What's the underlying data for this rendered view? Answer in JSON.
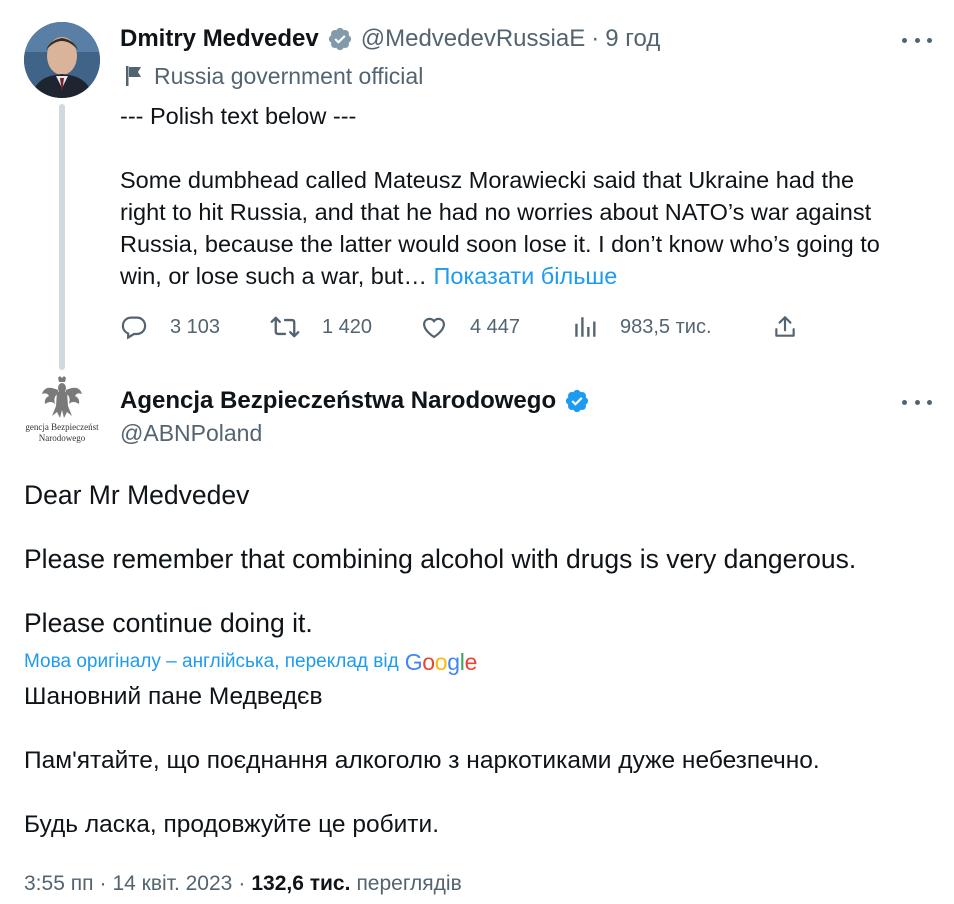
{
  "tweet1": {
    "author_name": "Dmitry Medvedev",
    "handle": "@MedvedevRussiaE",
    "dot": "·",
    "time": "9 год",
    "label": "Russia government official",
    "text_line1": "--- Polish text below ---",
    "text_p2_1": "Some dumbhead called Mateusz Morawiecki said that Ukraine had the",
    "text_p2_2": "right to hit Russia, and that he had no worries about NATO’s war against",
    "text_p2_3": "Russia, because the latter would soon lose it. I don’t know who’s going to",
    "text_p2_4": "win, or lose such a war, but…",
    "show_more": "Показати більше",
    "replies": "3 103",
    "retweets": "1 420",
    "likes": "4 447",
    "views": "983,5 тис.",
    "icons": [
      "verified-badge-icon",
      "flag-icon",
      "reply-icon",
      "retweet-icon",
      "like-icon",
      "views-icon",
      "share-icon",
      "more-icon"
    ]
  },
  "tweet2": {
    "author_name": "Agencja Bezpieczeństwa Narodowego",
    "handle": "@ABNPoland",
    "avatar_text_1": "gencja Bezpieczeńst",
    "avatar_text_2": "Narodowego",
    "line1": "Dear Mr Medvedev",
    "line2": "Please remember that combining alcohol with drugs is very dangerous.",
    "line3": "Please continue doing it.",
    "translate_note": "Мова оригіналу – англійська, переклад від",
    "google": {
      "G": "G",
      "o1": "o",
      "o2": "o",
      "g": "g",
      "l": "l",
      "e": "e"
    },
    "ua_line1": "Шановний пане Медведєв",
    "ua_line2": "Пам'ятайте, що поєднання алкоголю з наркотиками дуже небезпечно.",
    "ua_line3": "Будь ласка, продовжуйте це робити.",
    "timestamp": "3:55 пп",
    "date": "14 квіт. 2023",
    "sep": "·",
    "views_count": "132,6 тис.",
    "views_label": "переглядів"
  },
  "colors": {
    "accent": "#1d9bf0",
    "text": "#0f1419",
    "muted": "#536471",
    "thread_line": "#cfd9de",
    "google_blue": "#4285F4",
    "google_red": "#EA4335",
    "google_yellow": "#FBBC05",
    "google_green": "#34A853"
  }
}
